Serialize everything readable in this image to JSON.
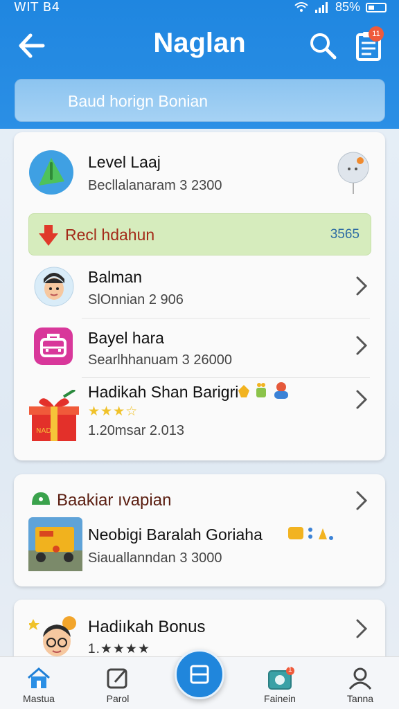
{
  "status_bar": {
    "left_text": "WIT B4",
    "right_text": "85%"
  },
  "app_bar": {
    "title": "Naglan",
    "badge_count": "11"
  },
  "search": {
    "text": "Baud horign Bonian"
  },
  "card1": {
    "level": {
      "title": "Level Laaj",
      "subtitle": "Becllalanaram 3 2300"
    },
    "highlight": {
      "label": "Recl hdahun",
      "value": "3565"
    },
    "items": [
      {
        "title": "Balman",
        "subtitle": "SlOnnian 2 906"
      },
      {
        "title": "Bayel hara",
        "subtitle": "Searlhhanuam 3 26000"
      },
      {
        "title": "Hadikah Shan Barigri",
        "stars_text": "★★★☆",
        "subtitle": "1.20msar 2.013"
      }
    ]
  },
  "card2": {
    "header": "Baakiar ıvapian",
    "item": {
      "title": "Neobigi Baralah Goriaha",
      "subtitle": "Siauallanndan 3 3000"
    }
  },
  "card3": {
    "title": "Hadiıkah Bonus",
    "stars_text": "1.★★★★"
  },
  "bottom_nav": {
    "items": [
      {
        "label": "Mastua"
      },
      {
        "label": "Parol"
      },
      {
        "label": "Fainein"
      },
      {
        "label": "Tanna"
      }
    ],
    "notification_badge": "1"
  },
  "colors": {
    "primary": "#2086dc",
    "highlight_bg": "#d6ecbd",
    "highlight_text": "#a32a18",
    "badge": "#ef5a3b"
  }
}
